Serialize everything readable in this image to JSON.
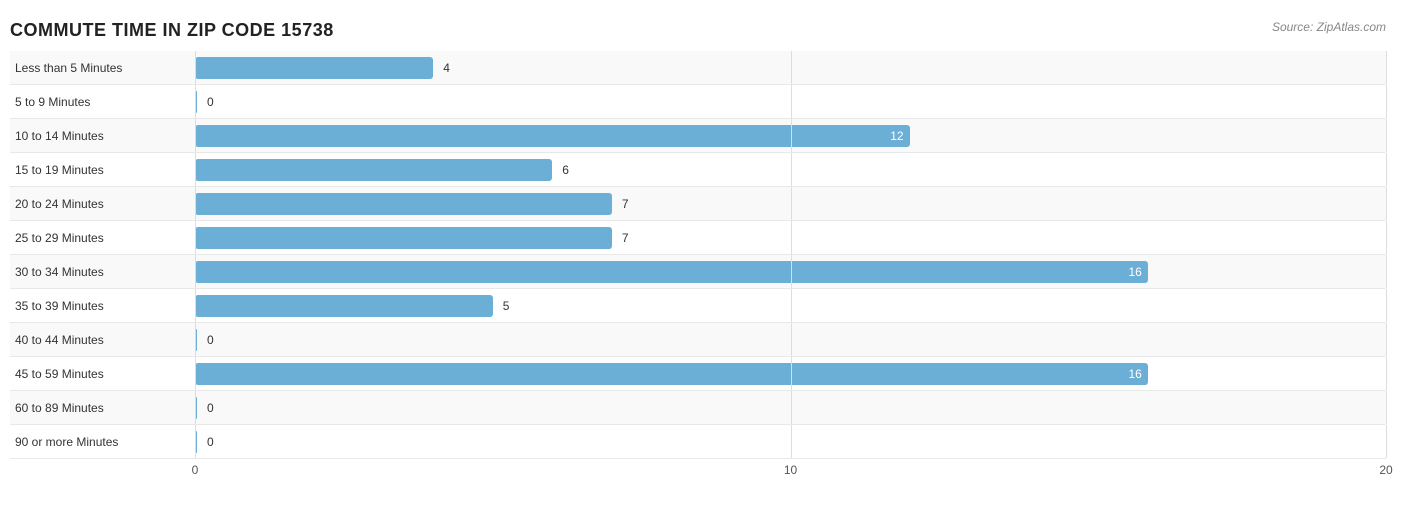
{
  "chart": {
    "title": "COMMUTE TIME IN ZIP CODE 15738",
    "source": "Source: ZipAtlas.com",
    "max_value": 20,
    "x_ticks": [
      0,
      10,
      20
    ],
    "bars": [
      {
        "label": "Less than 5 Minutes",
        "value": 4,
        "value_inside": false
      },
      {
        "label": "5 to 9 Minutes",
        "value": 0,
        "value_inside": false
      },
      {
        "label": "10 to 14 Minutes",
        "value": 12,
        "value_inside": true
      },
      {
        "label": "15 to 19 Minutes",
        "value": 6,
        "value_inside": false
      },
      {
        "label": "20 to 24 Minutes",
        "value": 7,
        "value_inside": false
      },
      {
        "label": "25 to 29 Minutes",
        "value": 7,
        "value_inside": false
      },
      {
        "label": "30 to 34 Minutes",
        "value": 16,
        "value_inside": true
      },
      {
        "label": "35 to 39 Minutes",
        "value": 5,
        "value_inside": false
      },
      {
        "label": "40 to 44 Minutes",
        "value": 0,
        "value_inside": false
      },
      {
        "label": "45 to 59 Minutes",
        "value": 16,
        "value_inside": true
      },
      {
        "label": "60 to 89 Minutes",
        "value": 0,
        "value_inside": false
      },
      {
        "label": "90 or more Minutes",
        "value": 0,
        "value_inside": false
      }
    ]
  }
}
